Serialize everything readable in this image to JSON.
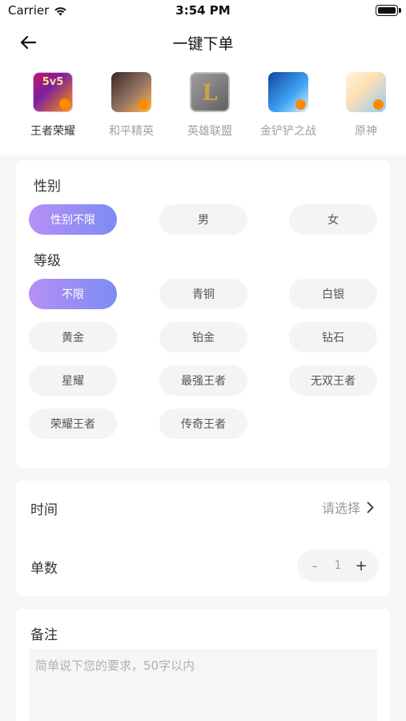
{
  "status_bar": {
    "carrier": "Carrier",
    "time": "3:54 PM"
  },
  "nav": {
    "title": "一键下单"
  },
  "games": [
    {
      "label": "王者荣耀",
      "icon": "honor-of-kings-icon",
      "mark": "5v5",
      "active": true
    },
    {
      "label": "和平精英",
      "icon": "peace-elite-icon",
      "mark": "",
      "active": false
    },
    {
      "label": "英雄联盟",
      "icon": "league-of-legends-icon",
      "mark": "L",
      "active": false
    },
    {
      "label": "金铲铲之战",
      "icon": "golden-spatula-icon",
      "mark": "",
      "active": false
    },
    {
      "label": "原神",
      "icon": "genshin-icon",
      "mark": "",
      "active": false
    }
  ],
  "filters": {
    "gender": {
      "title": "性别",
      "options": [
        "性别不限",
        "男",
        "女"
      ],
      "selected": "性别不限"
    },
    "level": {
      "title": "等级",
      "options": [
        "不限",
        "青铜",
        "白银",
        "黄金",
        "铂金",
        "钻石",
        "星耀",
        "最强王者",
        "无双王者",
        "荣耀王者",
        "传奇王者"
      ],
      "selected": "不限"
    }
  },
  "form": {
    "time_label": "时间",
    "time_placeholder": "请选择",
    "count_label": "单数",
    "count_value": "1",
    "minus_label": "-",
    "plus_label": "+"
  },
  "note": {
    "title": "备注",
    "placeholder": "简单说下您的要求，50字以内"
  },
  "colors": {
    "accent_start": "#b690f5",
    "accent_end": "#7b8cf3",
    "background": "#f5f6f8"
  }
}
